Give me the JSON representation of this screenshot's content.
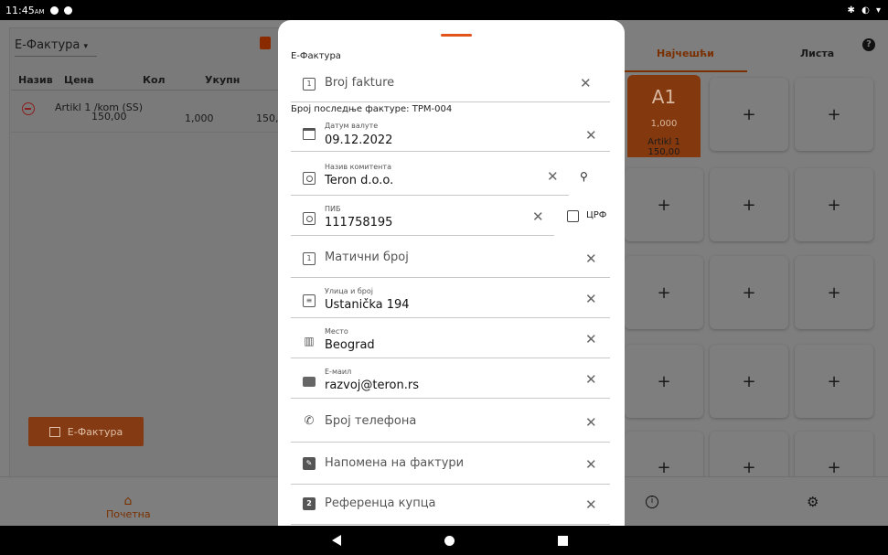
{
  "status_bar": {
    "time": "11:45",
    "ampm": "AM",
    "right_icons": "✱ ◐ ▾"
  },
  "left_panel": {
    "doc_type": "Е-Фактура",
    "columns": [
      "Назив",
      "Цена",
      "Кол",
      "Укупн"
    ],
    "row": {
      "name": "Artikl 1 /kom (SS)",
      "price": "150,00",
      "qty": "1,000",
      "total": "150,0"
    },
    "button_label": "Е-Фактура"
  },
  "right_panel": {
    "tabs": [
      "Најчешћи",
      "Листа"
    ],
    "help": "?",
    "tile_a1": {
      "code": "A1",
      "qty": "1,000",
      "name": "Artikl 1",
      "price": "150,00"
    },
    "plus": "+"
  },
  "bottom_nav": {
    "home_label": "Почетна",
    "info": "i"
  },
  "sheet": {
    "title": "Е-Фактура",
    "invoice_number_placeholder": "Broj fakture",
    "last_invoice_text": "Број последње фактуре: TPM-004",
    "currency_date_label": "Датум валуте",
    "currency_date_value": "09.12.2022",
    "client_name_label": "Назив комитента",
    "client_name_value": "Teron d.o.o.",
    "pib_label": "ПИБ",
    "pib_value": "111758195",
    "crf_label": "ЦРФ",
    "registry_placeholder": "Матични број",
    "street_label": "Улица и број",
    "street_value": "Ustanička 194",
    "city_label": "Место",
    "city_value": "Beograd",
    "email_label": "Е-маил",
    "email_value": "razvoj@teron.rs",
    "phone_placeholder": "Број телефона",
    "note_placeholder": "Напомена на фактури",
    "reference_placeholder": "Референца купца",
    "clear": "✕"
  }
}
